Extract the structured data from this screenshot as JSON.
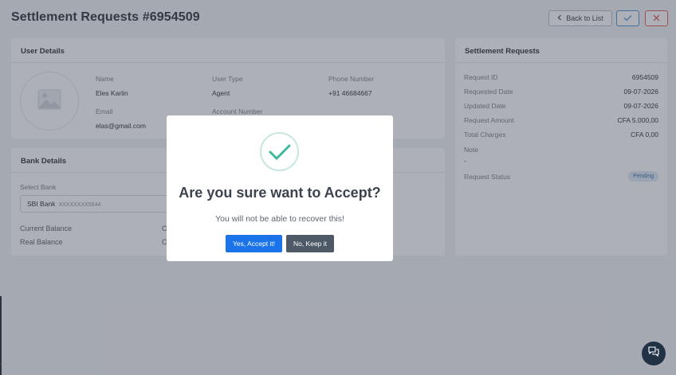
{
  "header": {
    "title": "Settlement Requests #6954509",
    "back_label": "Back to List",
    "accept_icon": "check-icon",
    "reject_icon": "close-icon"
  },
  "user_details": {
    "title": "User Details",
    "fields": [
      {
        "label": "Name",
        "value": "Eles Karlin"
      },
      {
        "label": "User Type",
        "value": "Agent"
      },
      {
        "label": "Phone Number",
        "value": "+91 46684667"
      },
      {
        "label": "Email",
        "value": "elas@gmail.com"
      },
      {
        "label": "Account Number",
        "value": ""
      }
    ]
  },
  "bank_details": {
    "title": "Bank Details",
    "select_label": "Select Bank",
    "selected_bank": "SBI Bank",
    "selected_account": "XXXXXXXX5544",
    "current_balance_label": "Current Balance",
    "current_balance_value": "C",
    "real_balance_label": "Real Balance",
    "real_balance_value": "C"
  },
  "settlement": {
    "title": "Settlement Requests",
    "rows": [
      {
        "label": "Request ID",
        "value": "6954509"
      },
      {
        "label": "Requested Date",
        "value": "09-07-2026"
      },
      {
        "label": "Updated Date",
        "value": "09-07-2026"
      },
      {
        "label": "Request Amount",
        "value": "CFA 5.000,00"
      },
      {
        "label": "Total Charges",
        "value": "CFA 0,00"
      }
    ],
    "note_label": "Note",
    "note_value": "-",
    "status_label": "Request Status",
    "status_value": "Pending"
  },
  "modal": {
    "title": "Are you sure want to Accept?",
    "text": "You will not be able to recover this!",
    "confirm_label": "Yes, Accept it!",
    "cancel_label": "No, Keep it"
  },
  "colors": {
    "primary": "#1a73e8",
    "success_check": "#3fb99d",
    "cancel": "#4e5968",
    "reject": "#e35a5a"
  }
}
